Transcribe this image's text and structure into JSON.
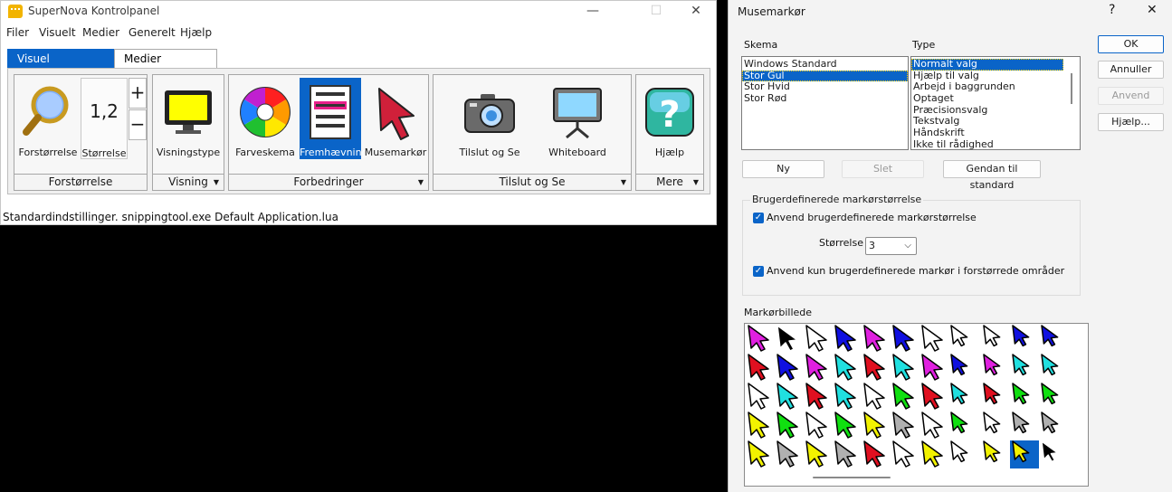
{
  "main_window": {
    "title": "SuperNova Kontrolpanel",
    "menu": [
      {
        "label": "Filer"
      },
      {
        "label": "Visuelt"
      },
      {
        "label": "Medier"
      },
      {
        "label": "Generelt"
      },
      {
        "label": "Hjælp"
      }
    ],
    "tabs": [
      {
        "label": "Visuel",
        "active": true
      },
      {
        "label": "Medier",
        "active": false
      }
    ],
    "groups": {
      "forstorrelse": {
        "label": "Forstørrelse",
        "zoom_button": "Forstørrelse",
        "size_value": "1,2",
        "size_label": "Størrelse",
        "plus": "+",
        "minus": "−"
      },
      "visning": {
        "label": "Visning",
        "view_type": "Visningstype"
      },
      "forbedringer": {
        "label": "Forbedringer",
        "color_scheme": "Farveskema",
        "highlight": "Fremhævning",
        "mouse_pointer": "Musemarkør"
      },
      "tilslut": {
        "label": "Tilslut og Se",
        "connect": "Tilslut og Se",
        "whiteboard": "Whiteboard"
      },
      "mere": {
        "label": "Mere",
        "help": "Hjælp"
      }
    },
    "status": "Standardindstillinger. snippingtool.exe Default Application.lua"
  },
  "dialog": {
    "title": "Musemarkør",
    "help_glyph": "?",
    "close_glyph": "✕",
    "scheme_label": "Skema",
    "schemes": [
      "Windows Standard",
      "Stor Gul",
      "Stor Hvid",
      "Stor Rød"
    ],
    "selected_scheme": "Stor Gul",
    "type_label": "Type",
    "types": [
      "Normalt valg",
      "Hjælp til valg",
      "Arbejd i baggrunden",
      "Optaget",
      "Præcisionsvalg",
      "Tekstvalg",
      "Håndskrift",
      "Ikke til rådighed"
    ],
    "selected_type": "Normalt valg",
    "buttons": {
      "ok": "OK",
      "cancel": "Annuller",
      "apply": "Anvend",
      "help": "Hjælp...",
      "new": "Ny",
      "delete": "Slet",
      "restore": "Gendan til standard"
    },
    "custom_size": {
      "legend": "Brugerdefinerede markørstørrelse",
      "apply_size": "Anvend brugerdefinerede markørstørrelse",
      "size_label": "Størrelse",
      "size_value": "3",
      "apply_magnified": "Anvend kun brugerdefinerede markør i forstørrede områder"
    },
    "cursor_image_label": "Markørbillede",
    "cursor_grid": {
      "rows": 5,
      "columns": 11,
      "colors": {
        "yellow": "#f2f200",
        "red": "#e01020",
        "magenta": "#e020e0",
        "blue": "#1010e0",
        "cyan": "#20e0e0",
        "green": "#10e010",
        "white": "#ffffff",
        "black": "#000000",
        "gray": "#b0b0b0",
        "selection": "#0a64c8"
      }
    }
  }
}
